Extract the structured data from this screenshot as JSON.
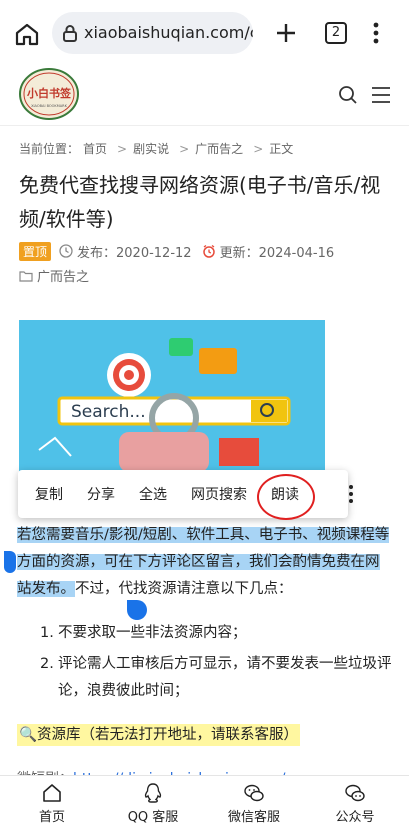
{
  "browser": {
    "url": "xiaobaishuqian.com/c",
    "tab_count": "2"
  },
  "site": {
    "logo_text": "小白书签",
    "logo_subtext": "XIAOBAI BOOKMARK"
  },
  "breadcrumb": {
    "prefix": "当前位置：",
    "items": [
      "首页",
      "剧实说",
      "广而告之",
      "正文"
    ]
  },
  "article": {
    "title": "免费代查找搜寻网络资源(电子书/音乐/视频/软件等)",
    "pin_label": "置顶",
    "published": "发布：2020-12-12",
    "updated": "更新：2024-04-16",
    "category": "广而告之",
    "hero_search_text": "Search...",
    "paragraph_selected": "若您需要音乐/影视/短剧、软件工具、电子书、视频课程等方面的资源，可在下方评论区留言，我们会酌情免费在网站发布。",
    "paragraph_rest": "不过，代找资源请注意以下几点：",
    "list": [
      {
        "num": "1.",
        "text": "不要求取一些非法资源内容；"
      },
      {
        "num": "2.",
        "text": "评论需人工审核后方可显示，请不要发表一些垃圾评论，浪费彼此时间；"
      }
    ],
    "resource_line": "🔍资源库（若无法打开地址，请联系客服）",
    "cut_prefix": "微短剧：",
    "cut_link": "https://dj.xiaobaishuqian.com/"
  },
  "context_menu": {
    "copy": "复制",
    "share": "分享",
    "select_all": "全选",
    "web_search": "网页搜索",
    "read_aloud": "朗读"
  },
  "bottom_nav": {
    "home": "首页",
    "qq": "QQ 客服",
    "wechat": "微信客服",
    "official": "公众号"
  },
  "colors": {
    "selection": "#a8d4f5",
    "handle": "#1a73e8",
    "pin": "#f0a020",
    "highlight": "#fff7a0",
    "circle": "#e02020"
  }
}
